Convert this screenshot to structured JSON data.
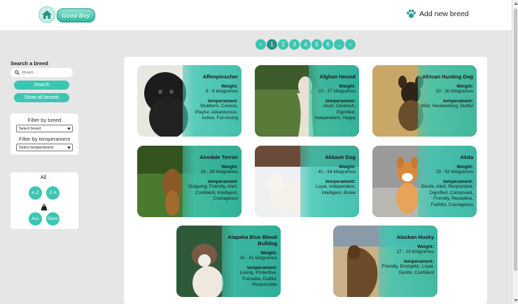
{
  "header": {
    "logo_text": "Good Boy",
    "add_breed_label": "Add new breed"
  },
  "pagination": {
    "prev": "‹",
    "next": "›",
    "pages": [
      "1",
      "2",
      "3",
      "4",
      "5",
      "6",
      "..."
    ],
    "active_page": "1"
  },
  "sidebar": {
    "search_title": "Search a breed",
    "search_placeholder": "Breed...",
    "search_button": "Search",
    "show_all_button": "Show all breeds",
    "filter_breed_label": "Filter by breed",
    "filter_breed_value": "Select breed",
    "filter_temperament_label": "Filter by temperament",
    "filter_temperament_value": "Select temperament",
    "sort_alpha_icon": "AZ",
    "sort_az": "A-Z",
    "sort_za": "Z-A",
    "sort_weight_icon": "kg",
    "sort_asc": "Asc",
    "sort_desc": "Desc"
  },
  "labels": {
    "weight": "Weight:",
    "temperament": "temperament:"
  },
  "breeds": [
    {
      "name": "Affenpinscher",
      "weight": "3 - 6 kilogramos",
      "temperament": "Stubborn, Curious, Playful, Adventurous, Active, Fun-loving"
    },
    {
      "name": "Afghan Hound",
      "weight": "23 - 27 kilogramos",
      "temperament": "Aloof, Clownish, Dignified, Independent, Happy"
    },
    {
      "name": "African Hunting Dog",
      "weight": "20 - 30 kilogramos",
      "temperament": "Wild, Hardworking, Dutiful"
    },
    {
      "name": "Airedale Terrier",
      "weight": "18 - 29 kilogramos",
      "temperament": "Outgoing, Friendly, Alert, Confident, Intelligent, Courageous"
    },
    {
      "name": "Akbash Dog",
      "weight": "41 - 54 kilogramos",
      "temperament": "Loyal, Independent, Intelligent, Brave"
    },
    {
      "name": "Akita",
      "weight": "29 - 52 kilogramos",
      "temperament": "Docile, Alert, Responsive, Dignified, Composed, Friendly, Receptive, Faithful, Courageous"
    },
    {
      "name": "Alapaha Blue Blood Bulldog",
      "weight": "25 - 41 kilogramos",
      "temperament": "Loving, Protective, Trainable, Dutiful, Responsible"
    },
    {
      "name": "Alaskan Husky",
      "weight": "17 - 23 kilogramos",
      "temperament": "Friendly, Energetic, Loyal, Gentle, Confident"
    }
  ],
  "colors": {
    "accent": "#3cc6b1",
    "accent_dark": "#2a8f82",
    "background": "#e6e6e6"
  }
}
